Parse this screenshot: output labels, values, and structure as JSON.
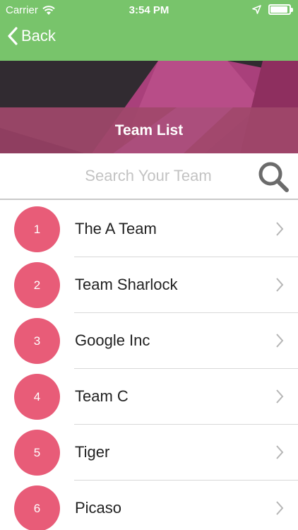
{
  "status": {
    "carrier": "Carrier",
    "time": "3:54 PM"
  },
  "nav": {
    "back_label": "Back"
  },
  "banner": {
    "title": "Team List"
  },
  "search": {
    "placeholder": "Search Your Team",
    "value": ""
  },
  "teams": [
    {
      "index": "1",
      "name": "The A Team"
    },
    {
      "index": "2",
      "name": "Team Sharlock"
    },
    {
      "index": "3",
      "name": "Google Inc"
    },
    {
      "index": "4",
      "name": "Team C"
    },
    {
      "index": "5",
      "name": "Tiger"
    },
    {
      "index": "6",
      "name": "Picaso"
    }
  ],
  "colors": {
    "nav_green": "#78c46b",
    "badge_pink": "#e85c78",
    "banner_dark": "#312b31",
    "banner_magenta": "#b0447a"
  },
  "icons": {
    "back": "chevron-left-icon",
    "search": "magnifier-icon",
    "row": "chevron-right-icon"
  }
}
